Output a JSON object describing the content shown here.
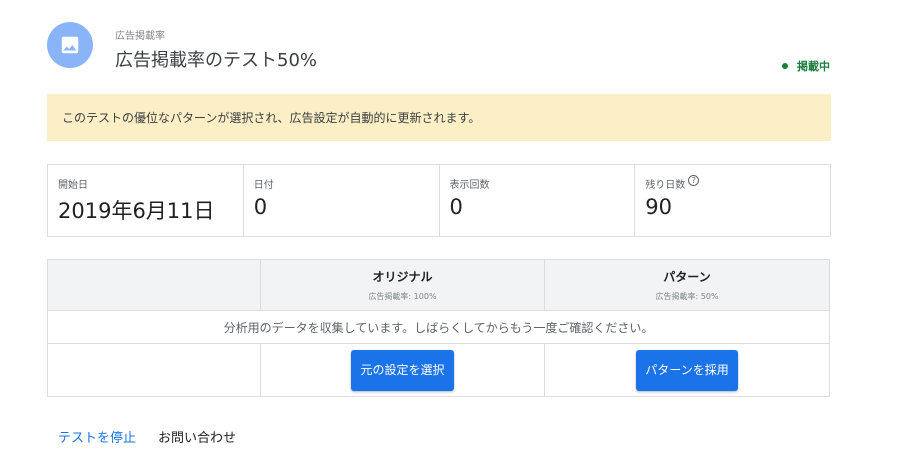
{
  "header": {
    "icon": "image-icon",
    "subtitle": "広告掲載率",
    "title": "広告掲載率のテスト50%",
    "status": "掲載中",
    "icon_color": "#8ab4f8",
    "status_color": "#188038"
  },
  "notice": {
    "text": "このテストの優位なパターンが選択され、広告設定が自動的に更新されます。",
    "background": "#fcefc6"
  },
  "stats": [
    {
      "label": "開始日",
      "value": "2019年6月11日"
    },
    {
      "label": "日付",
      "value": "0"
    },
    {
      "label": "表示回数",
      "value": "0"
    },
    {
      "label": "残り日数",
      "value": "90",
      "help_icon": "?"
    }
  ],
  "comparison": {
    "columns": [
      {
        "name": "オリジナル",
        "sub": "広告掲載率: 100%"
      },
      {
        "name": "パターン",
        "sub": "広告掲載率: 50%"
      }
    ],
    "message": "分析用のデータを収集しています。しばらくしてからもう一度ご確認ください。",
    "buttons": {
      "select_original": "元の設定を選択",
      "adopt_pattern": "パターンを採用"
    },
    "button_color": "#1a73e8"
  },
  "footer": {
    "stop_test": "テストを停止",
    "contact": "お問い合わせ"
  }
}
